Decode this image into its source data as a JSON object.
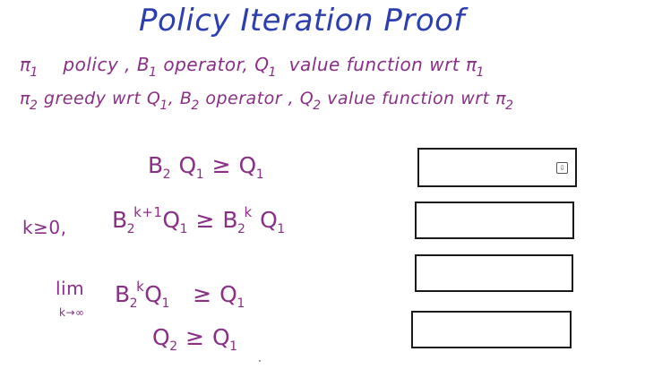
{
  "title": "Policy Iteration Proof",
  "definitions": {
    "line1": {
      "pi": "π",
      "pi_sub": "1",
      "policy": "policy ,",
      "B": "B",
      "B_sub": "1",
      "operator": "operator,",
      "Q": "Q",
      "Q_sub": "1",
      "vf_text": "value function wrt",
      "pi2": "π",
      "pi2_sub": "1"
    },
    "line2": {
      "pi": "π",
      "pi_sub": "2",
      "greedy": "greedy wrt",
      "Q": "Q",
      "Q_sub": "1",
      "comma1": ",",
      "B": "B",
      "B_sub": "2",
      "operator": "operator ,",
      "Q2": "Q",
      "Q2_sub": "2",
      "vf_text": "value function wrt",
      "pi2": "π",
      "pi2_sub": "2"
    }
  },
  "equations": {
    "eq1": {
      "B": "B",
      "B_sub": "2",
      "Q": "Q",
      "Q_sub": "1",
      "rel": "≥",
      "Q2": "Q",
      "Q2_sub": "1"
    },
    "eq2": {
      "condition": "k≥0,",
      "B": "B",
      "B_sub": "2",
      "B_sup": "k+1",
      "Q": "Q",
      "Q_sub": "1",
      "rel": "≥",
      "B2": "B",
      "B2_sub": "2",
      "B2_sup": "k",
      "Q2": "Q",
      "Q2_sub": "1"
    },
    "eq3": {
      "lim": "lim",
      "lim_sub": "k→∞",
      "B": "B",
      "B_sub": "2",
      "B_sup": "k",
      "Q": "Q",
      "Q_sub": "1",
      "rel": "≥",
      "Q2": "Q",
      "Q2_sub": "1"
    },
    "eq4": {
      "Q": "Q",
      "Q_sub": "2",
      "rel": "≥",
      "Q2": "Q",
      "Q2_sub": "1"
    }
  },
  "answer_boxes": {
    "box1_icon": "⇩"
  },
  "colors": {
    "title": "#2b3fb0",
    "ink": "#8a2f86",
    "box_border": "#1a1a1a"
  }
}
